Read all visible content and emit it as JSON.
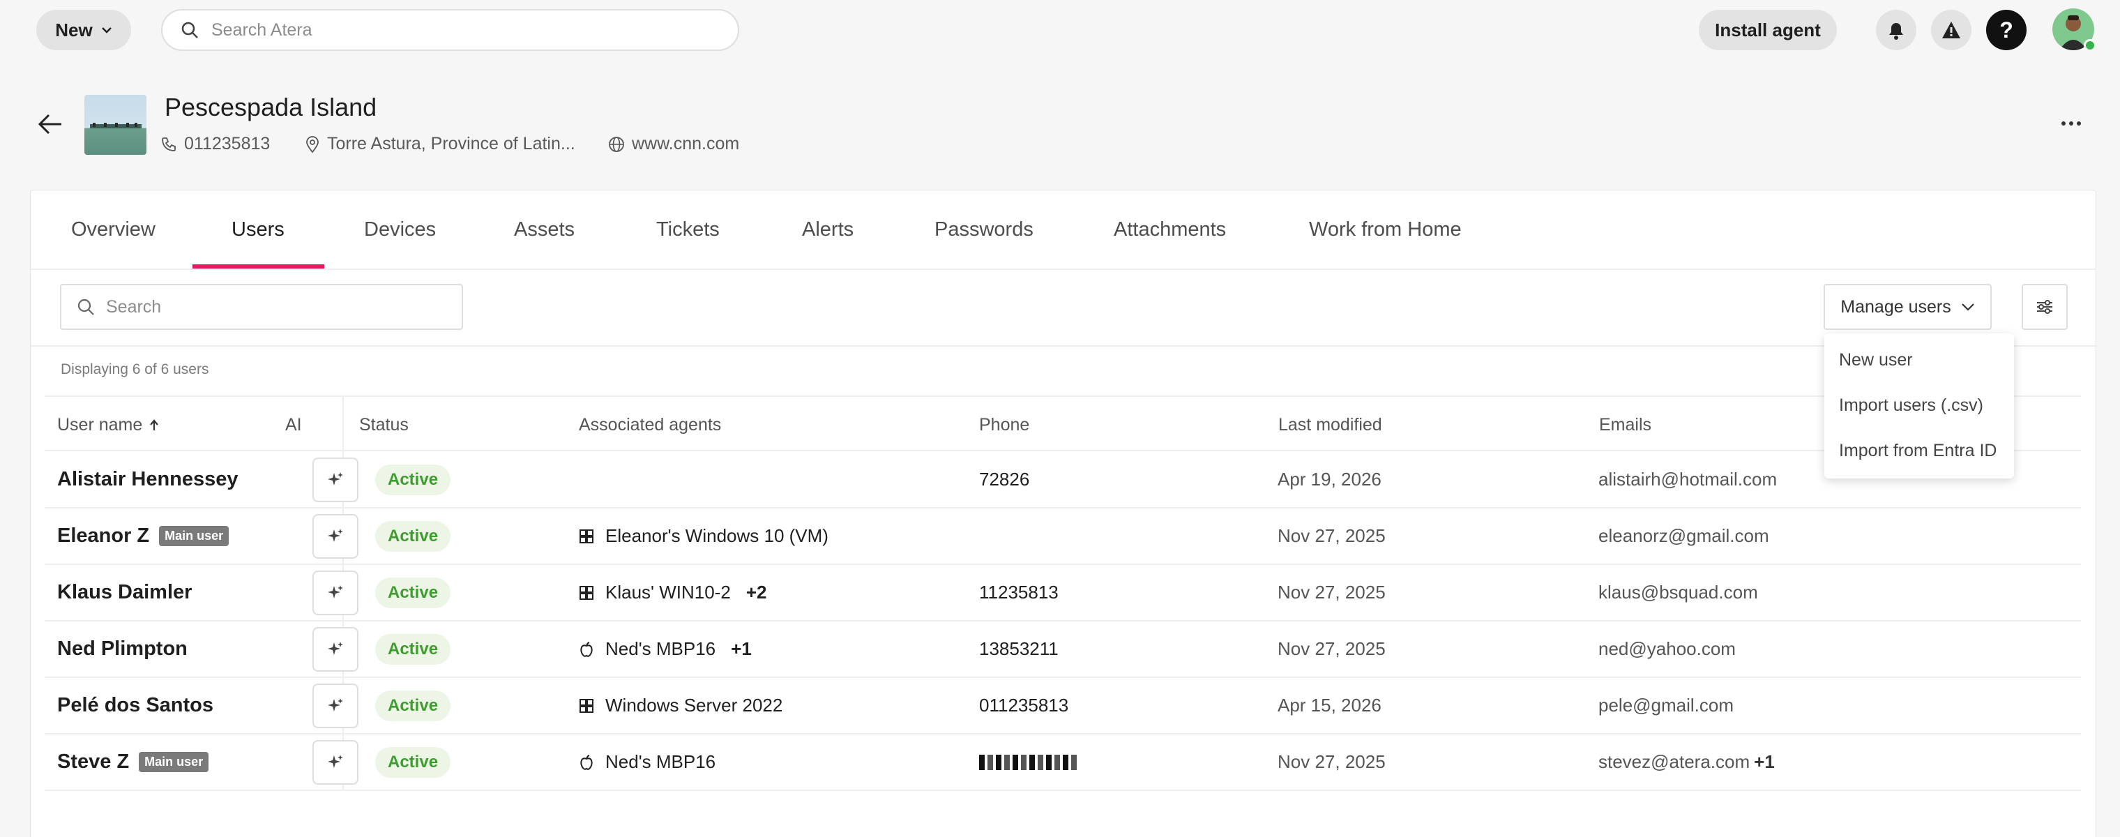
{
  "topbar": {
    "new_label": "New",
    "search_placeholder": "Search Atera",
    "install_label": "Install agent",
    "help_label": "?"
  },
  "customer": {
    "name": "Pescespada Island",
    "phone": "011235813",
    "location": "Torre Astura, Province of Latin...",
    "website": "www.cnn.com"
  },
  "tabs": [
    {
      "label": "Overview"
    },
    {
      "label": "Users",
      "active": true
    },
    {
      "label": "Devices"
    },
    {
      "label": "Assets"
    },
    {
      "label": "Tickets"
    },
    {
      "label": "Alerts"
    },
    {
      "label": "Passwords"
    },
    {
      "label": "Attachments"
    },
    {
      "label": "Work from Home"
    }
  ],
  "users": {
    "search_placeholder": "Search",
    "manage_label": "Manage users",
    "displaying": "Displaying 6 of 6 users",
    "columns": {
      "username": "User name",
      "ai": "AI",
      "status": "Status",
      "agents": "Associated agents",
      "phone": "Phone",
      "modified": "Last modified",
      "emails": "Emails"
    },
    "rows": [
      {
        "name": "Alistair Hennessey",
        "badge": "",
        "status": "Active",
        "agent": "",
        "agent_os": "",
        "agent_more": "",
        "phone": "72826",
        "modified": "Apr 19, 2026",
        "email": "alistairh@hotmail.com",
        "email_more": ""
      },
      {
        "name": "Eleanor Z",
        "badge": "Main user",
        "status": "Active",
        "agent": "Eleanor's Windows 10 (VM)",
        "agent_os": "windows",
        "agent_more": "",
        "phone": "",
        "modified": "Nov 27, 2025",
        "email": "eleanorz@gmail.com",
        "email_more": ""
      },
      {
        "name": "Klaus Daimler",
        "badge": "",
        "status": "Active",
        "agent": "Klaus' WIN10-2",
        "agent_os": "windows",
        "agent_more": "+2",
        "phone": "11235813",
        "modified": "Nov 27, 2025",
        "email": "klaus@bsquad.com",
        "email_more": ""
      },
      {
        "name": "Ned Plimpton",
        "badge": "",
        "status": "Active",
        "agent": "Ned's MBP16",
        "agent_os": "apple",
        "agent_more": "+1",
        "phone": "13853211",
        "modified": "Nov 27, 2025",
        "email": "ned@yahoo.com",
        "email_more": ""
      },
      {
        "name": "Pelé dos Santos",
        "badge": "",
        "status": "Active",
        "agent": "Windows Server 2022",
        "agent_os": "windows",
        "agent_more": "",
        "phone": "011235813",
        "modified": "Apr 15, 2026",
        "email": "pele@gmail.com",
        "email_more": ""
      },
      {
        "name": "Steve Z",
        "badge": "Main user",
        "status": "Active",
        "agent": "Ned's MBP16",
        "agent_os": "apple",
        "agent_more": "",
        "phone": "",
        "phone_redacted": true,
        "modified": "Nov 27, 2025",
        "email": "stevez@atera.com",
        "email_more": "+1"
      }
    ]
  },
  "manage_menu": {
    "items": [
      "New user",
      "Import users (.csv)",
      "Import from Entra ID"
    ]
  },
  "colors": {
    "accent": "#e4195b",
    "status_green": "#3e9d2f",
    "status_bg": "#edf5e6"
  }
}
